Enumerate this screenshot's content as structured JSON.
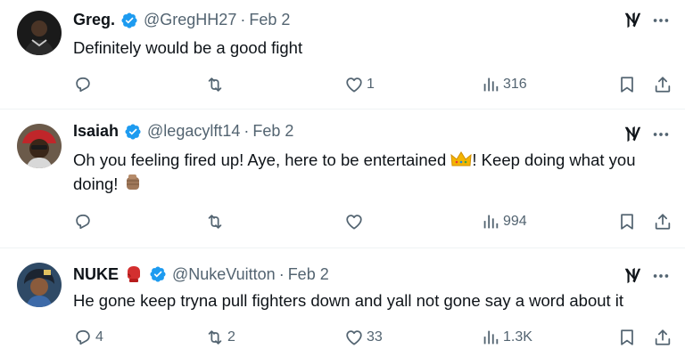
{
  "tweets": [
    {
      "name": "Greg.",
      "handle": "@GregHH27",
      "dot": "·",
      "date": "Feb 2",
      "text": "Definitely would be a good fight",
      "replies": "",
      "retweets": "",
      "likes": "1",
      "views": "316"
    },
    {
      "name": "Isaiah",
      "handle": "@legacylft14",
      "dot": "·",
      "date": "Feb 2",
      "text_part1": "Oh you feeling fired up! Aye, here to be entertained ",
      "text_part2": "! Keep doing what you doing! ",
      "replies": "",
      "retweets": "",
      "likes": "",
      "views": "994"
    },
    {
      "name": "NUKE",
      "handle": "@NukeVuitton",
      "dot": "·",
      "date": "Feb 2",
      "text": "He gone keep tryna pull fighters down and yall not gone say a word about it",
      "replies": "4",
      "retweets": "2",
      "likes": "33",
      "views": "1.3K"
    }
  ],
  "colors": {
    "verified": "#1d9bf0",
    "secondary_text": "#536471",
    "divider": "#eff3f4"
  },
  "icons": [
    "verified-badge-icon",
    "grok-icon",
    "more-icon",
    "reply-icon",
    "retweet-icon",
    "like-icon",
    "views-icon",
    "bookmark-icon",
    "share-icon",
    "crown-emoji",
    "fist-emoji",
    "boxing-glove-emoji"
  ]
}
